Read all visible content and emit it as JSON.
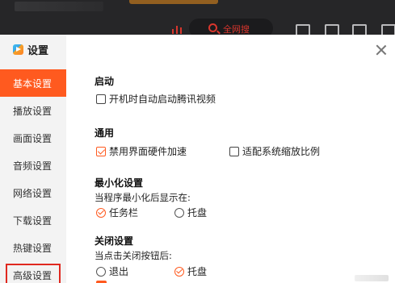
{
  "topbar": {
    "search_label": "全网搜",
    "accent_color": "#d8362d"
  },
  "dialog": {
    "title": "设置",
    "close_icon": "close-icon",
    "nav": [
      {
        "label": "基本设置",
        "active": true
      },
      {
        "label": "播放设置"
      },
      {
        "label": "画面设置"
      },
      {
        "label": "音频设置"
      },
      {
        "label": "网络设置"
      },
      {
        "label": "下载设置"
      },
      {
        "label": "热键设置"
      },
      {
        "label": "高级设置",
        "highlighted": true
      }
    ],
    "sections": {
      "startup": {
        "title": "启动",
        "options": [
          {
            "label": "开机时自动启动腾讯视频",
            "checked": false
          }
        ]
      },
      "general": {
        "title": "通用",
        "options": [
          {
            "label": "禁用界面硬件加速",
            "checked": true
          },
          {
            "label": "适配系统缩放比例",
            "checked": false
          }
        ]
      },
      "minimize": {
        "title": "最小化设置",
        "description": "当程序最小化后显示在:",
        "options": [
          {
            "label": "任务栏",
            "selected": true
          },
          {
            "label": "托盘",
            "selected": false
          }
        ]
      },
      "close": {
        "title": "关闭设置",
        "description": "当点击关闭按钮后:",
        "options": [
          {
            "label": "退出",
            "selected": false
          },
          {
            "label": "托盘",
            "selected": true
          }
        ]
      }
    },
    "colors": {
      "accent": "#ff5a1f",
      "highlight_box": "#e0281f",
      "sidebar_bg": "#f3f3f3"
    }
  }
}
